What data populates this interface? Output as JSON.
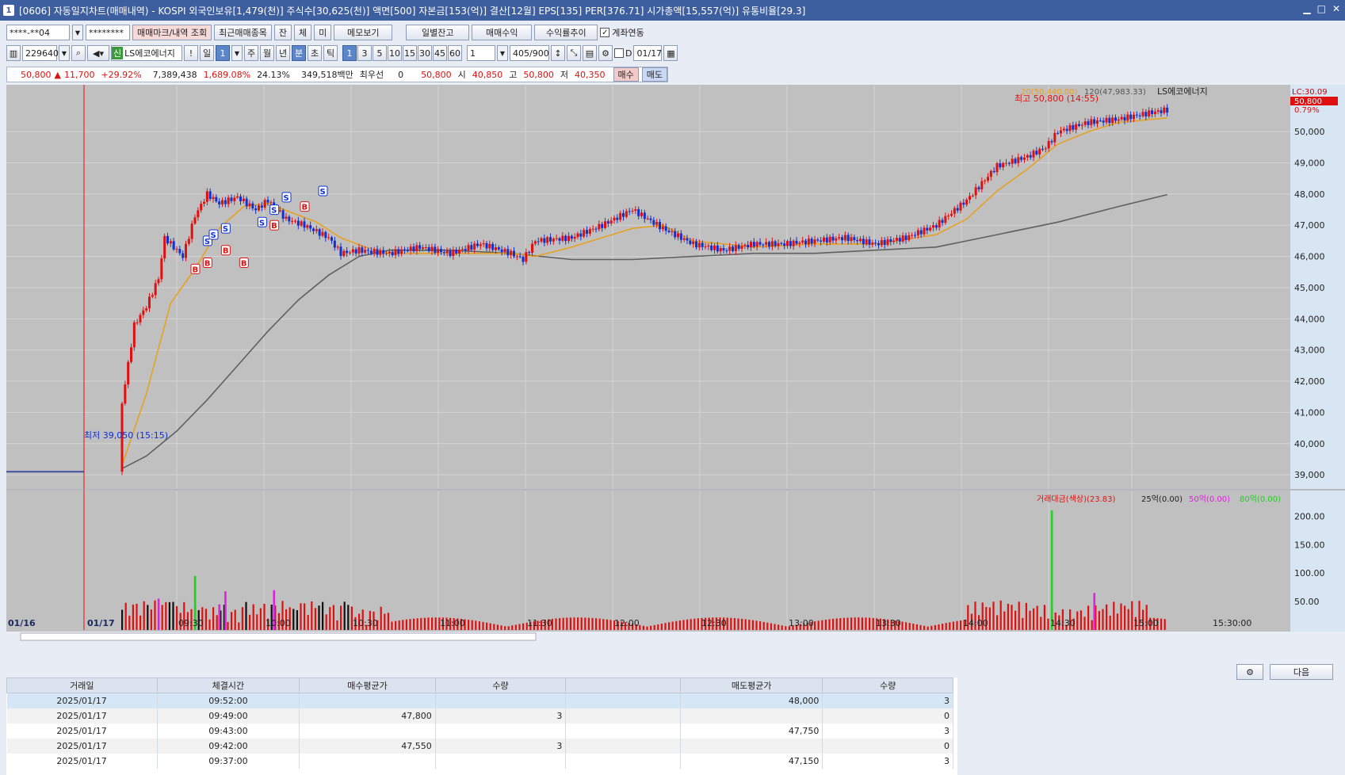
{
  "window": {
    "title": "[0606] 자동일지차트(매매내역) - KOSPI 외국인보유[1,479(천)] 주식수[30,625(천)] 액면[500] 자본금[153(억)] 결산[12월] EPS[135] PER[376.71] 시가총액[15,557(억)] 유통비율[29.3]",
    "icon": "1"
  },
  "toolbar1": {
    "account": "****-**04",
    "password": "********",
    "btn_mark": "매매마크/내역 조회",
    "btn_recent": "최근매매종목",
    "btn_jan": "잔",
    "btn_che": "체",
    "btn_mi": "미",
    "btn_memo": "메모보기",
    "btn_daily": "일별잔고",
    "btn_profit": "매매수익",
    "btn_rate": "수익률추이",
    "link_label": "계좌연동"
  },
  "toolbar2": {
    "code": "229640",
    "stock_tag": "신",
    "stock_name": "LS에코에너지",
    "excl": "!",
    "period_day": "일",
    "period_num": "1",
    "week": "주",
    "month": "월",
    "year": "년",
    "minute": "분",
    "tick_cho": "초",
    "tick": "틱",
    "intervals": [
      "1",
      "3",
      "5",
      "10",
      "15",
      "30",
      "45",
      "60"
    ],
    "interval_sel": "1",
    "count_val": "1",
    "range": "405/900",
    "date_flag": "D",
    "date": "01/17"
  },
  "quote": {
    "price": "50,800",
    "change": "11,700",
    "rate": "+29.92%",
    "volume": "7,389,438",
    "vol_rate": "1,689.08%",
    "turnover": "24.13%",
    "amount": "349,518백만",
    "best": "최우선",
    "best_val": "0",
    "bid": "50,800",
    "open_label": "시",
    "open": "40,850",
    "high_label": "고",
    "high": "50,800",
    "low_label": "저",
    "low": "40,350",
    "buy": "매수",
    "sell": "매도"
  },
  "chart_data": {
    "type": "candlestick",
    "legend_ma20": "20(50,440.00)",
    "legend_ma120": "120(47,983.33)",
    "legend_name": "LS에코에너지",
    "legend_lc": "LC:30.09",
    "current_price_label": "50,800",
    "current_change_label": "0.79%",
    "high_annotation": "최고 50,800 (14:55)",
    "low_annotation": "최저 39,050 (15:15)",
    "y_ticks": [
      "50,000",
      "49,000",
      "48,000",
      "47,000",
      "46,000",
      "45,000",
      "44,000",
      "43,000",
      "42,000",
      "41,000",
      "40,000",
      "39,000"
    ],
    "y_values": [
      50000,
      49000,
      48000,
      47000,
      46000,
      45000,
      44000,
      43000,
      42000,
      41000,
      40000,
      39000
    ],
    "ylim": [
      38800,
      51300
    ],
    "x_ticks": [
      "01/16",
      "01/17",
      "09:30",
      "10:00",
      "10:30",
      "11:00",
      "11:30",
      "12:00",
      "12:30",
      "13:00",
      "13:30",
      "14:00",
      "14:30",
      "15:00",
      "15:30:00"
    ],
    "volume_legend": {
      "label": "거래대금(색상)(23.83)",
      "l25": "25억(0.00)",
      "l50": "50억(0.00)",
      "l80": "80억(0.00)"
    },
    "volume_ticks": [
      "200.00",
      "150.00",
      "100.00",
      "50.00"
    ],
    "volume_values": [
      200,
      150,
      100,
      50
    ],
    "price_path": [
      [
        0,
        39100
      ],
      [
        5,
        39100
      ],
      [
        6,
        41300
      ],
      [
        8,
        43800
      ],
      [
        10,
        44400
      ],
      [
        12,
        45300
      ],
      [
        13,
        46600
      ],
      [
        16,
        46000
      ],
      [
        18,
        47300
      ],
      [
        20,
        48000
      ],
      [
        22,
        47700
      ],
      [
        25,
        47900
      ],
      [
        28,
        47500
      ],
      [
        30,
        47800
      ],
      [
        33,
        47200
      ],
      [
        36,
        47000
      ],
      [
        40,
        46600
      ],
      [
        42,
        46100
      ],
      [
        45,
        46200
      ],
      [
        50,
        46100
      ],
      [
        55,
        46300
      ],
      [
        60,
        46100
      ],
      [
        65,
        46400
      ],
      [
        70,
        46100
      ],
      [
        72,
        45900
      ],
      [
        74,
        46500
      ],
      [
        80,
        46600
      ],
      [
        85,
        47000
      ],
      [
        90,
        47500
      ],
      [
        95,
        46900
      ],
      [
        100,
        46400
      ],
      [
        105,
        46200
      ],
      [
        110,
        46400
      ],
      [
        115,
        46400
      ],
      [
        120,
        46500
      ],
      [
        125,
        46600
      ],
      [
        130,
        46400
      ],
      [
        135,
        46600
      ],
      [
        140,
        47000
      ],
      [
        145,
        47800
      ],
      [
        150,
        48900
      ],
      [
        155,
        49200
      ],
      [
        158,
        49500
      ],
      [
        160,
        50000
      ],
      [
        165,
        50300
      ],
      [
        170,
        50400
      ],
      [
        175,
        50600
      ],
      [
        178,
        50700
      ]
    ],
    "ma20_path": [
      [
        6,
        39300
      ],
      [
        10,
        41600
      ],
      [
        14,
        44500
      ],
      [
        18,
        45600
      ],
      [
        22,
        46900
      ],
      [
        26,
        47600
      ],
      [
        30,
        47700
      ],
      [
        34,
        47400
      ],
      [
        38,
        47100
      ],
      [
        42,
        46600
      ],
      [
        46,
        46300
      ],
      [
        50,
        46100
      ],
      [
        60,
        46100
      ],
      [
        70,
        46100
      ],
      [
        74,
        46000
      ],
      [
        80,
        46300
      ],
      [
        90,
        46900
      ],
      [
        95,
        47000
      ],
      [
        100,
        46500
      ],
      [
        110,
        46300
      ],
      [
        120,
        46400
      ],
      [
        130,
        46400
      ],
      [
        140,
        46700
      ],
      [
        145,
        47200
      ],
      [
        150,
        48100
      ],
      [
        155,
        48800
      ],
      [
        160,
        49600
      ],
      [
        165,
        50000
      ],
      [
        170,
        50300
      ],
      [
        178,
        50440
      ]
    ],
    "ma120_path": [
      [
        6,
        39200
      ],
      [
        10,
        39600
      ],
      [
        15,
        40400
      ],
      [
        20,
        41400
      ],
      [
        25,
        42500
      ],
      [
        30,
        43600
      ],
      [
        35,
        44600
      ],
      [
        40,
        45400
      ],
      [
        45,
        46000
      ],
      [
        50,
        46200
      ],
      [
        60,
        46200
      ],
      [
        70,
        46100
      ],
      [
        80,
        45900
      ],
      [
        90,
        45900
      ],
      [
        100,
        46000
      ],
      [
        110,
        46100
      ],
      [
        120,
        46100
      ],
      [
        130,
        46200
      ],
      [
        140,
        46300
      ],
      [
        150,
        46700
      ],
      [
        160,
        47100
      ],
      [
        170,
        47600
      ],
      [
        178,
        47983
      ]
    ],
    "trade_marks": [
      {
        "t": 18,
        "p": 45600,
        "k": "B"
      },
      {
        "t": 20,
        "p": 45800,
        "k": "B"
      },
      {
        "t": 20,
        "p": 46500,
        "k": "S"
      },
      {
        "t": 21,
        "p": 46700,
        "k": "S"
      },
      {
        "t": 23,
        "p": 46900,
        "k": "S"
      },
      {
        "t": 23,
        "p": 46200,
        "k": "B"
      },
      {
        "t": 26,
        "p": 45800,
        "k": "B"
      },
      {
        "t": 29,
        "p": 47100,
        "k": "S"
      },
      {
        "t": 31,
        "p": 47500,
        "k": "S"
      },
      {
        "t": 31,
        "p": 47000,
        "k": "B"
      },
      {
        "t": 33,
        "p": 47900,
        "k": "S"
      },
      {
        "t": 36,
        "p": 47600,
        "k": "B"
      },
      {
        "t": 39,
        "p": 48100,
        "k": "S"
      }
    ]
  },
  "table": {
    "headers": [
      "거래일",
      "체결시간",
      "매수평균가",
      "수량",
      "",
      "매도평균가",
      "수량"
    ],
    "rows": [
      [
        "2025/01/17",
        "09:52:00",
        "",
        "",
        "",
        "48,000",
        "3"
      ],
      [
        "2025/01/17",
        "09:49:00",
        "47,800",
        "3",
        "",
        "",
        "0"
      ],
      [
        "2025/01/17",
        "09:43:00",
        "",
        "",
        "",
        "47,750",
        "3"
      ],
      [
        "2025/01/17",
        "09:42:00",
        "47,550",
        "3",
        "",
        "",
        "0"
      ],
      [
        "2025/01/17",
        "09:37:00",
        "",
        "",
        "",
        "47,150",
        "3"
      ]
    ],
    "next": "다음"
  }
}
